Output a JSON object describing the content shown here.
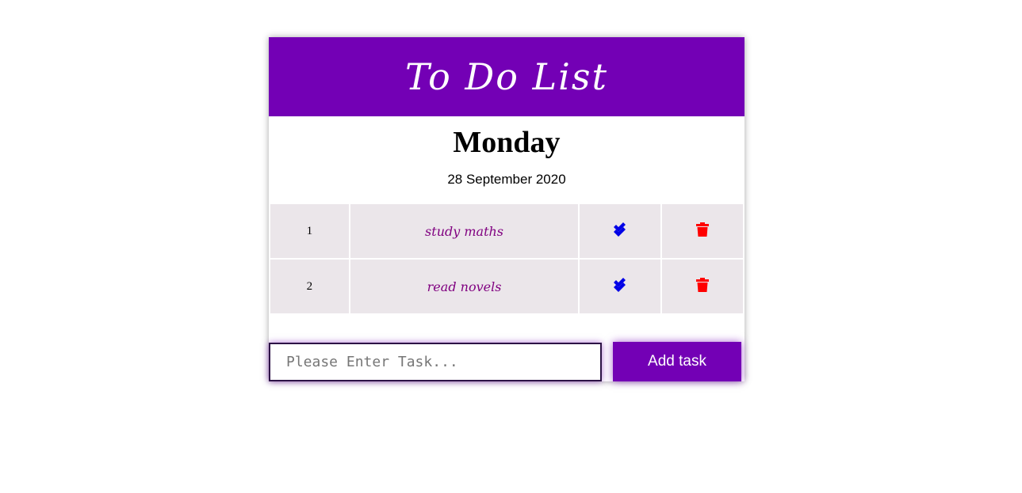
{
  "header": {
    "title": "To Do List"
  },
  "day": "Monday",
  "date": "28 September 2020",
  "tasks": [
    {
      "number": "1",
      "text": "study maths",
      "done_icon": "double-check-icon",
      "delete_icon": "trash-icon"
    },
    {
      "number": "2",
      "text": "read novels",
      "done_icon": "double-check-icon",
      "delete_icon": "trash-icon"
    }
  ],
  "input": {
    "placeholder": "Please Enter Task...",
    "value": ""
  },
  "add_button": {
    "label": "Add task"
  },
  "colors": {
    "accent": "#7300b5",
    "task_text": "#800080",
    "check": "#0000e6",
    "trash": "#ff0000",
    "row_bg": "#ebe6ea"
  }
}
